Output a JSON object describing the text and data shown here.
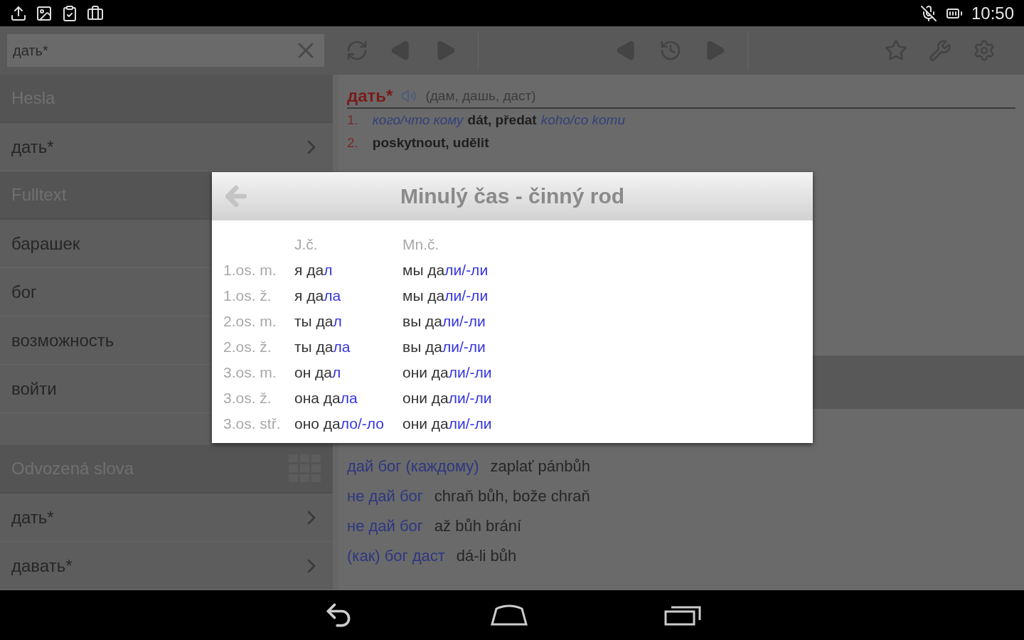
{
  "status_bar": {
    "time": "10:50"
  },
  "search": {
    "value": "дать*"
  },
  "sidebar": {
    "sections": [
      {
        "title": "Hesla",
        "items": [
          {
            "label": "дать*",
            "kind": "link"
          }
        ]
      },
      {
        "title": "Fulltext",
        "items": [
          {
            "label": "барашек",
            "kind": "plain"
          },
          {
            "label": "бог",
            "kind": "plain"
          },
          {
            "label": "возможность",
            "kind": "plain"
          },
          {
            "label": "войти",
            "kind": "plain"
          }
        ]
      },
      {
        "title": "Odvozená slova",
        "items": [
          {
            "label": "дать*",
            "kind": "link"
          },
          {
            "label": "давать*",
            "kind": "link"
          }
        ]
      }
    ]
  },
  "entry": {
    "headword": "дать*",
    "forms": "(дам, дашь, даст)",
    "senses": [
      {
        "number": "1.",
        "parts": [
          {
            "kind": "ru",
            "text": "кого/что кому"
          },
          {
            "kind": "cz",
            "text": "dát, předat"
          },
          {
            "kind": "hint",
            "text": "koho/co komu"
          }
        ]
      },
      {
        "number": "2.",
        "parts": [
          {
            "kind": "cz",
            "text": "poskytnout, udělit"
          }
        ]
      }
    ]
  },
  "phrases": [
    {
      "ru": "дай бог (каждому)",
      "cz": "zaplať pánbůh"
    },
    {
      "ru": "не дай бог",
      "cz": "chraň bůh, bože chraň"
    },
    {
      "ru": "не дай бог",
      "cz": "až bůh brání"
    },
    {
      "ru": "(как) бог даст",
      "cz": "dá-li bůh"
    }
  ],
  "dialog": {
    "title": "Minulý čas - činný rod",
    "columns": [
      "J.č.",
      "Mn.č."
    ],
    "rows": [
      {
        "label": "1.os. m.",
        "singular": {
          "stem": "я да",
          "ending": "л"
        },
        "plural": {
          "stem": "мы да",
          "ending": "ли/-ли"
        }
      },
      {
        "label": "1.os. ž.",
        "singular": {
          "stem": "я да",
          "ending": "ла"
        },
        "plural": {
          "stem": "мы да",
          "ending": "ли/-ли"
        }
      },
      {
        "label": "2.os. m.",
        "singular": {
          "stem": "ты да",
          "ending": "л"
        },
        "plural": {
          "stem": "вы да",
          "ending": "ли/-ли"
        }
      },
      {
        "label": "2.os. ž.",
        "singular": {
          "stem": "ты да",
          "ending": "ла"
        },
        "plural": {
          "stem": "вы да",
          "ending": "ли/-ли"
        }
      },
      {
        "label": "3.os. m.",
        "singular": {
          "stem": "он да",
          "ending": "л"
        },
        "plural": {
          "stem": "они да",
          "ending": "ли/-ли"
        }
      },
      {
        "label": "3.os. ž.",
        "singular": {
          "stem": "она да",
          "ending": "ла"
        },
        "plural": {
          "stem": "они да",
          "ending": "ли/-ли"
        }
      },
      {
        "label": "3.os. stř.",
        "singular": {
          "stem": "оно да",
          "ending": "ло/-ло"
        },
        "plural": {
          "stem": "они да",
          "ending": "ли/-ли"
        }
      }
    ]
  }
}
